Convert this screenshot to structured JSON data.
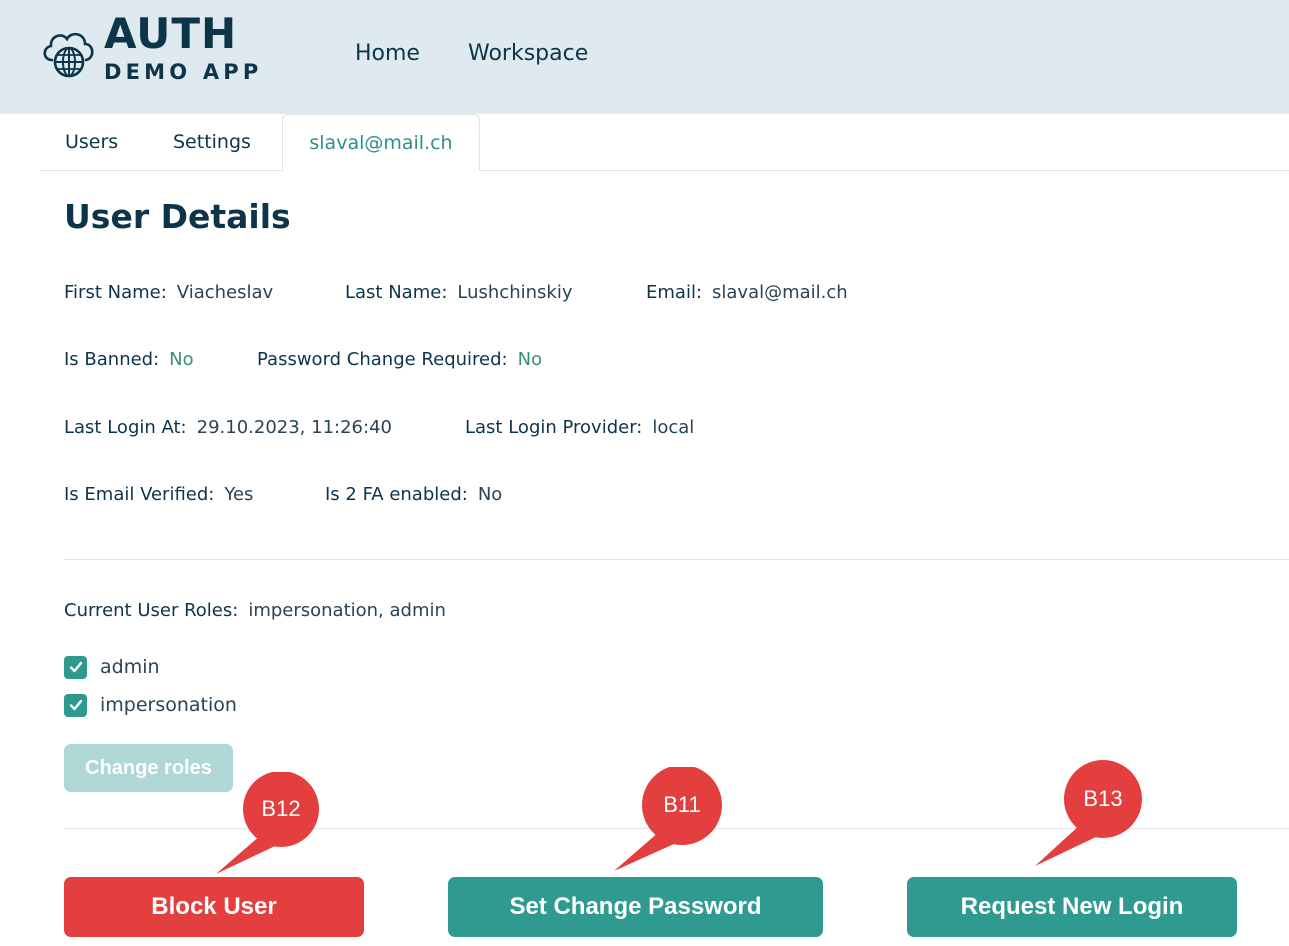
{
  "header": {
    "logo": {
      "title": "AUTH",
      "subtitle": "DEMO APP",
      "icon": "globe-cloud-icon"
    },
    "nav": [
      {
        "label": "Home"
      },
      {
        "label": "Workspace"
      }
    ]
  },
  "tabs": [
    {
      "label": "Users",
      "active": false
    },
    {
      "label": "Settings",
      "active": false
    },
    {
      "label": "slaval@mail.ch",
      "active": true
    }
  ],
  "page": {
    "title": "User Details"
  },
  "details": {
    "first_name": {
      "label": "First Name:",
      "value": "Viacheslav"
    },
    "last_name": {
      "label": "Last Name:",
      "value": "Lushchinskiy"
    },
    "email": {
      "label": "Email:",
      "value": "slaval@mail.ch"
    },
    "is_banned": {
      "label": "Is Banned:",
      "value": "No"
    },
    "password_change_required": {
      "label": "Password Change Required:",
      "value": "No"
    },
    "last_login_at": {
      "label": "Last Login At:",
      "value": "29.10.2023, 11:26:40"
    },
    "last_login_provider": {
      "label": "Last Login Provider:",
      "value": "local"
    },
    "is_email_verified": {
      "label": "Is Email Verified:",
      "value": "Yes"
    },
    "is_2fa_enabled": {
      "label": "Is 2 FA enabled:",
      "value": "No"
    }
  },
  "roles": {
    "current_label": "Current User Roles:",
    "current_value": "impersonation, admin",
    "options": [
      {
        "label": "admin",
        "checked": true
      },
      {
        "label": "impersonation",
        "checked": true
      }
    ],
    "change_button": "Change roles"
  },
  "actions": {
    "block_user": "Block User",
    "set_change_password": "Set Change Password",
    "request_new_login": "Request New Login"
  },
  "annotations": [
    {
      "label": "B12"
    },
    {
      "label": "B11"
    },
    {
      "label": "B13"
    }
  ],
  "colors": {
    "header_bg": "#dfeaf0",
    "primary_text": "#0d3549",
    "accent_teal": "#2f9a90",
    "danger_red": "#e43f3f",
    "status_green": "#3c8f77",
    "disabled_teal": "#afd7d6"
  }
}
